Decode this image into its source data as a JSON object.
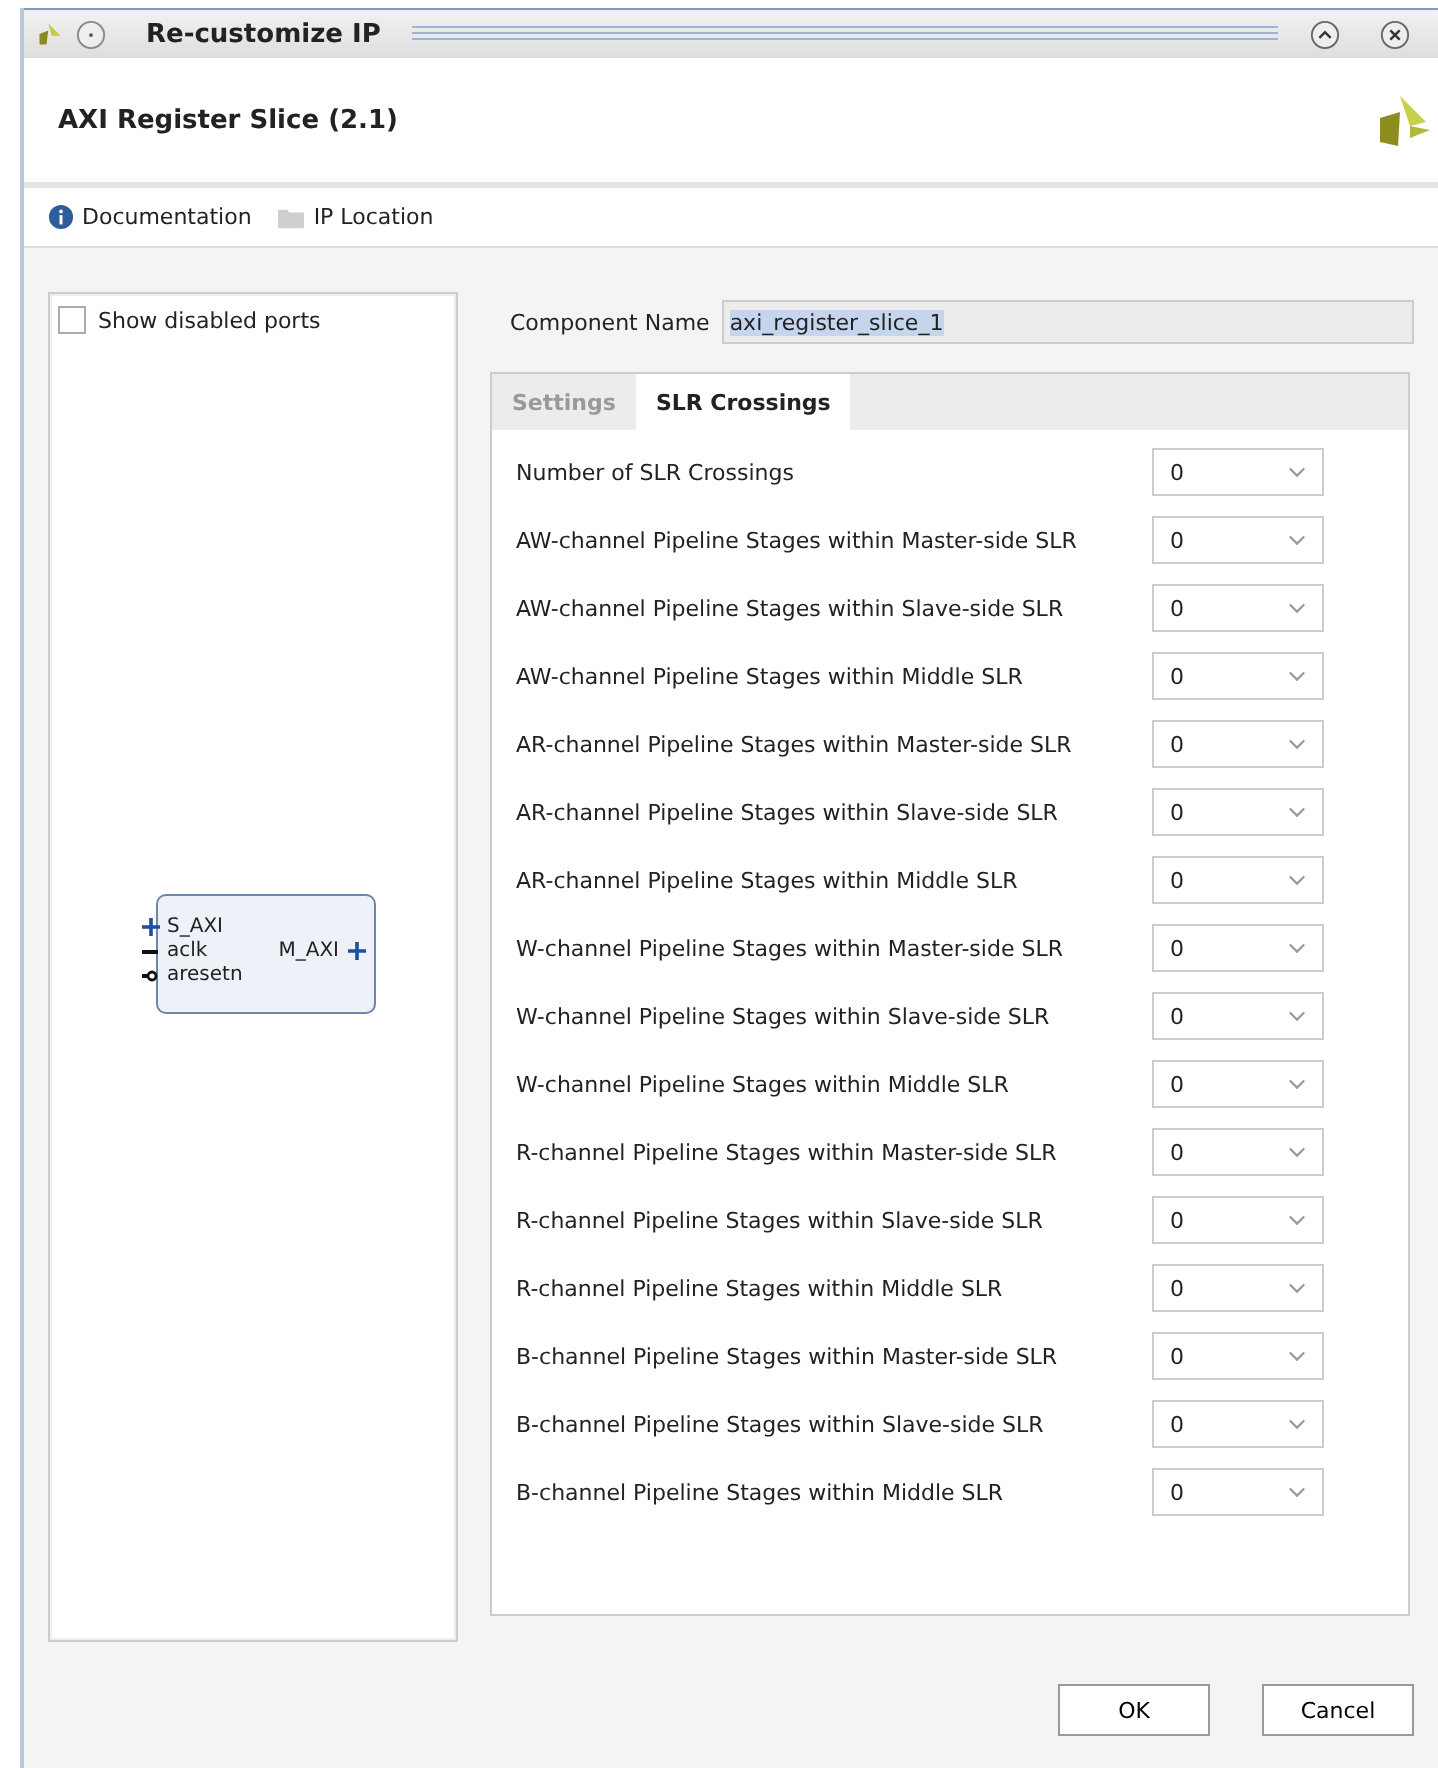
{
  "window": {
    "title": "Re-customize IP"
  },
  "header": {
    "title": "AXI Register Slice (2.1)"
  },
  "toolbar": [
    {
      "kind": "info",
      "label": "Documentation"
    },
    {
      "kind": "folder",
      "label": "IP Location"
    }
  ],
  "symbol_panel": {
    "show_disabled_ports": {
      "label": "Show disabled ports",
      "checked": false
    },
    "block": {
      "left_ports": [
        {
          "kind": "bus",
          "name": "S_AXI"
        },
        {
          "kind": "clock",
          "name": "aclk"
        },
        {
          "kind": "reset",
          "name": "aresetn"
        }
      ],
      "right_ports": [
        {
          "kind": "bus",
          "name": "M_AXI"
        }
      ]
    }
  },
  "component_name": {
    "label": "Component Name",
    "value": "axi_register_slice_1"
  },
  "tabs": [
    {
      "label": "Settings",
      "selected": false
    },
    {
      "label": "SLR Crossings",
      "selected": true
    }
  ],
  "parameters": [
    {
      "label": "Number of SLR Crossings",
      "value": "0"
    },
    {
      "label": "AW-channel Pipeline Stages within Master-side SLR",
      "value": "0"
    },
    {
      "label": "AW-channel Pipeline Stages within Slave-side SLR",
      "value": "0"
    },
    {
      "label": "AW-channel Pipeline Stages within Middle SLR",
      "value": "0"
    },
    {
      "label": "AR-channel Pipeline Stages within Master-side SLR",
      "value": "0"
    },
    {
      "label": "AR-channel Pipeline Stages within Slave-side SLR",
      "value": "0"
    },
    {
      "label": "AR-channel Pipeline Stages within Middle SLR",
      "value": "0"
    },
    {
      "label": "W-channel Pipeline Stages within Master-side SLR",
      "value": "0"
    },
    {
      "label": "W-channel Pipeline Stages within Slave-side SLR",
      "value": "0"
    },
    {
      "label": "W-channel Pipeline Stages within Middle SLR",
      "value": "0"
    },
    {
      "label": "R-channel Pipeline Stages within Master-side SLR",
      "value": "0"
    },
    {
      "label": "R-channel Pipeline Stages within Slave-side SLR",
      "value": "0"
    },
    {
      "label": "R-channel Pipeline Stages within Middle SLR",
      "value": "0"
    },
    {
      "label": "B-channel Pipeline Stages within Master-side SLR",
      "value": "0"
    },
    {
      "label": "B-channel Pipeline Stages within Slave-side SLR",
      "value": "0"
    },
    {
      "label": "B-channel Pipeline Stages within Middle SLR",
      "value": "0"
    }
  ],
  "buttons": [
    "OK",
    "Cancel"
  ]
}
